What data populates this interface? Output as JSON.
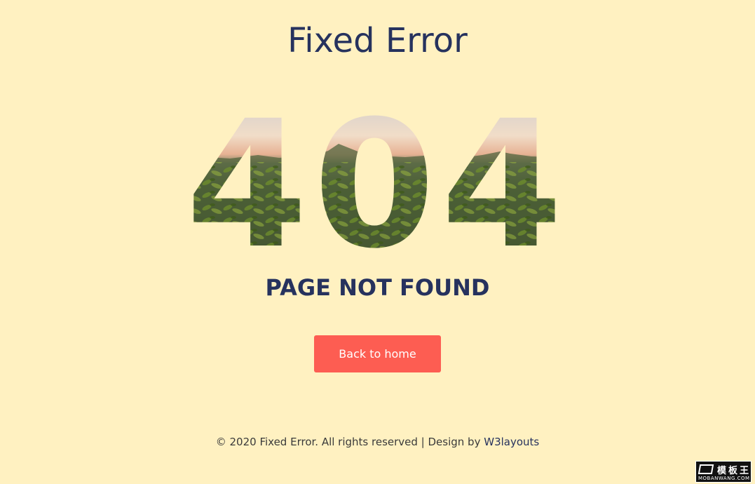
{
  "page": {
    "title": "Fixed Error",
    "error_code": "404",
    "error_message": "PAGE NOT FOUND",
    "back_button_label": "Back to home"
  },
  "footer": {
    "copyright": "© 2020 Fixed Error. All rights reserved | Design by ",
    "designer_link": "W3layouts"
  },
  "watermark": {
    "main": "模板王",
    "sub": "MOBANWANG.COM"
  },
  "colors": {
    "background": "#fff1c1",
    "heading": "#26325e",
    "button": "#fd5d52",
    "button_text": "#ffffff"
  },
  "icons": {
    "hero_texture": "crop-field-landscape-image"
  }
}
